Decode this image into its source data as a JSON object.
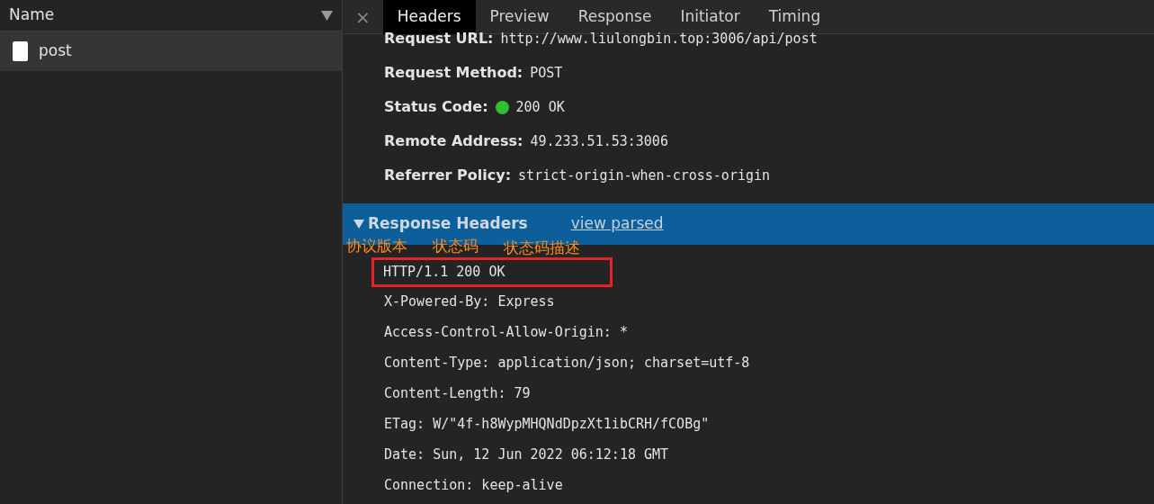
{
  "sidebar": {
    "column_header": "Name",
    "requests": [
      {
        "name": "post",
        "selected": true
      }
    ]
  },
  "close_button": "×",
  "tabs": [
    {
      "label": "Headers",
      "selected": true
    },
    {
      "label": "Preview",
      "selected": false
    },
    {
      "label": "Response",
      "selected": false
    },
    {
      "label": "Initiator",
      "selected": false
    },
    {
      "label": "Timing",
      "selected": false
    }
  ],
  "general": [
    {
      "key": "Request URL:",
      "value": "http://www.liulongbin.top:3006/api/post",
      "kind": "plain"
    },
    {
      "key": "Request Method:",
      "value": "POST",
      "kind": "plain"
    },
    {
      "key": "Status Code:",
      "value": "200 OK",
      "kind": "status",
      "color": "#2ec02e"
    },
    {
      "key": "Remote Address:",
      "value": "49.233.51.53:3006",
      "kind": "plain"
    },
    {
      "key": "Referrer Policy:",
      "value": "strict-origin-when-cross-origin",
      "kind": "plain"
    }
  ],
  "response_headers": {
    "title": "Response Headers",
    "expanded": true,
    "toggle_link": "view parsed",
    "annotations": [
      "协议版本",
      "状态码",
      "状态码描述"
    ],
    "status_line": "HTTP/1.1 200 OK",
    "headers": [
      "X-Powered-By: Express",
      "Access-Control-Allow-Origin: *",
      "Content-Type: application/json; charset=utf-8",
      "Content-Length: 79",
      "ETag: W/\"4f-h8WypMHQNdDpzXt1ibCRH/fCOBg\"",
      "Date: Sun, 12 Jun 2022 06:12:18 GMT",
      "Connection: keep-alive"
    ]
  }
}
